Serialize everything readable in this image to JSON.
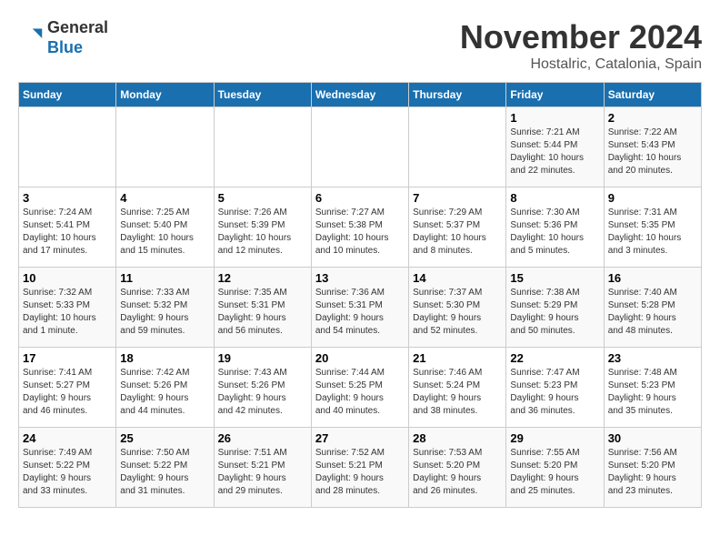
{
  "logo": {
    "general": "General",
    "blue": "Blue"
  },
  "title": "November 2024",
  "location": "Hostalric, Catalonia, Spain",
  "headers": [
    "Sunday",
    "Monday",
    "Tuesday",
    "Wednesday",
    "Thursday",
    "Friday",
    "Saturday"
  ],
  "weeks": [
    [
      {
        "day": "",
        "info": ""
      },
      {
        "day": "",
        "info": ""
      },
      {
        "day": "",
        "info": ""
      },
      {
        "day": "",
        "info": ""
      },
      {
        "day": "",
        "info": ""
      },
      {
        "day": "1",
        "info": "Sunrise: 7:21 AM\nSunset: 5:44 PM\nDaylight: 10 hours\nand 22 minutes."
      },
      {
        "day": "2",
        "info": "Sunrise: 7:22 AM\nSunset: 5:43 PM\nDaylight: 10 hours\nand 20 minutes."
      }
    ],
    [
      {
        "day": "3",
        "info": "Sunrise: 7:24 AM\nSunset: 5:41 PM\nDaylight: 10 hours\nand 17 minutes."
      },
      {
        "day": "4",
        "info": "Sunrise: 7:25 AM\nSunset: 5:40 PM\nDaylight: 10 hours\nand 15 minutes."
      },
      {
        "day": "5",
        "info": "Sunrise: 7:26 AM\nSunset: 5:39 PM\nDaylight: 10 hours\nand 12 minutes."
      },
      {
        "day": "6",
        "info": "Sunrise: 7:27 AM\nSunset: 5:38 PM\nDaylight: 10 hours\nand 10 minutes."
      },
      {
        "day": "7",
        "info": "Sunrise: 7:29 AM\nSunset: 5:37 PM\nDaylight: 10 hours\nand 8 minutes."
      },
      {
        "day": "8",
        "info": "Sunrise: 7:30 AM\nSunset: 5:36 PM\nDaylight: 10 hours\nand 5 minutes."
      },
      {
        "day": "9",
        "info": "Sunrise: 7:31 AM\nSunset: 5:35 PM\nDaylight: 10 hours\nand 3 minutes."
      }
    ],
    [
      {
        "day": "10",
        "info": "Sunrise: 7:32 AM\nSunset: 5:33 PM\nDaylight: 10 hours\nand 1 minute."
      },
      {
        "day": "11",
        "info": "Sunrise: 7:33 AM\nSunset: 5:32 PM\nDaylight: 9 hours\nand 59 minutes."
      },
      {
        "day": "12",
        "info": "Sunrise: 7:35 AM\nSunset: 5:31 PM\nDaylight: 9 hours\nand 56 minutes."
      },
      {
        "day": "13",
        "info": "Sunrise: 7:36 AM\nSunset: 5:31 PM\nDaylight: 9 hours\nand 54 minutes."
      },
      {
        "day": "14",
        "info": "Sunrise: 7:37 AM\nSunset: 5:30 PM\nDaylight: 9 hours\nand 52 minutes."
      },
      {
        "day": "15",
        "info": "Sunrise: 7:38 AM\nSunset: 5:29 PM\nDaylight: 9 hours\nand 50 minutes."
      },
      {
        "day": "16",
        "info": "Sunrise: 7:40 AM\nSunset: 5:28 PM\nDaylight: 9 hours\nand 48 minutes."
      }
    ],
    [
      {
        "day": "17",
        "info": "Sunrise: 7:41 AM\nSunset: 5:27 PM\nDaylight: 9 hours\nand 46 minutes."
      },
      {
        "day": "18",
        "info": "Sunrise: 7:42 AM\nSunset: 5:26 PM\nDaylight: 9 hours\nand 44 minutes."
      },
      {
        "day": "19",
        "info": "Sunrise: 7:43 AM\nSunset: 5:26 PM\nDaylight: 9 hours\nand 42 minutes."
      },
      {
        "day": "20",
        "info": "Sunrise: 7:44 AM\nSunset: 5:25 PM\nDaylight: 9 hours\nand 40 minutes."
      },
      {
        "day": "21",
        "info": "Sunrise: 7:46 AM\nSunset: 5:24 PM\nDaylight: 9 hours\nand 38 minutes."
      },
      {
        "day": "22",
        "info": "Sunrise: 7:47 AM\nSunset: 5:23 PM\nDaylight: 9 hours\nand 36 minutes."
      },
      {
        "day": "23",
        "info": "Sunrise: 7:48 AM\nSunset: 5:23 PM\nDaylight: 9 hours\nand 35 minutes."
      }
    ],
    [
      {
        "day": "24",
        "info": "Sunrise: 7:49 AM\nSunset: 5:22 PM\nDaylight: 9 hours\nand 33 minutes."
      },
      {
        "day": "25",
        "info": "Sunrise: 7:50 AM\nSunset: 5:22 PM\nDaylight: 9 hours\nand 31 minutes."
      },
      {
        "day": "26",
        "info": "Sunrise: 7:51 AM\nSunset: 5:21 PM\nDaylight: 9 hours\nand 29 minutes."
      },
      {
        "day": "27",
        "info": "Sunrise: 7:52 AM\nSunset: 5:21 PM\nDaylight: 9 hours\nand 28 minutes."
      },
      {
        "day": "28",
        "info": "Sunrise: 7:53 AM\nSunset: 5:20 PM\nDaylight: 9 hours\nand 26 minutes."
      },
      {
        "day": "29",
        "info": "Sunrise: 7:55 AM\nSunset: 5:20 PM\nDaylight: 9 hours\nand 25 minutes."
      },
      {
        "day": "30",
        "info": "Sunrise: 7:56 AM\nSunset: 5:20 PM\nDaylight: 9 hours\nand 23 minutes."
      }
    ]
  ]
}
